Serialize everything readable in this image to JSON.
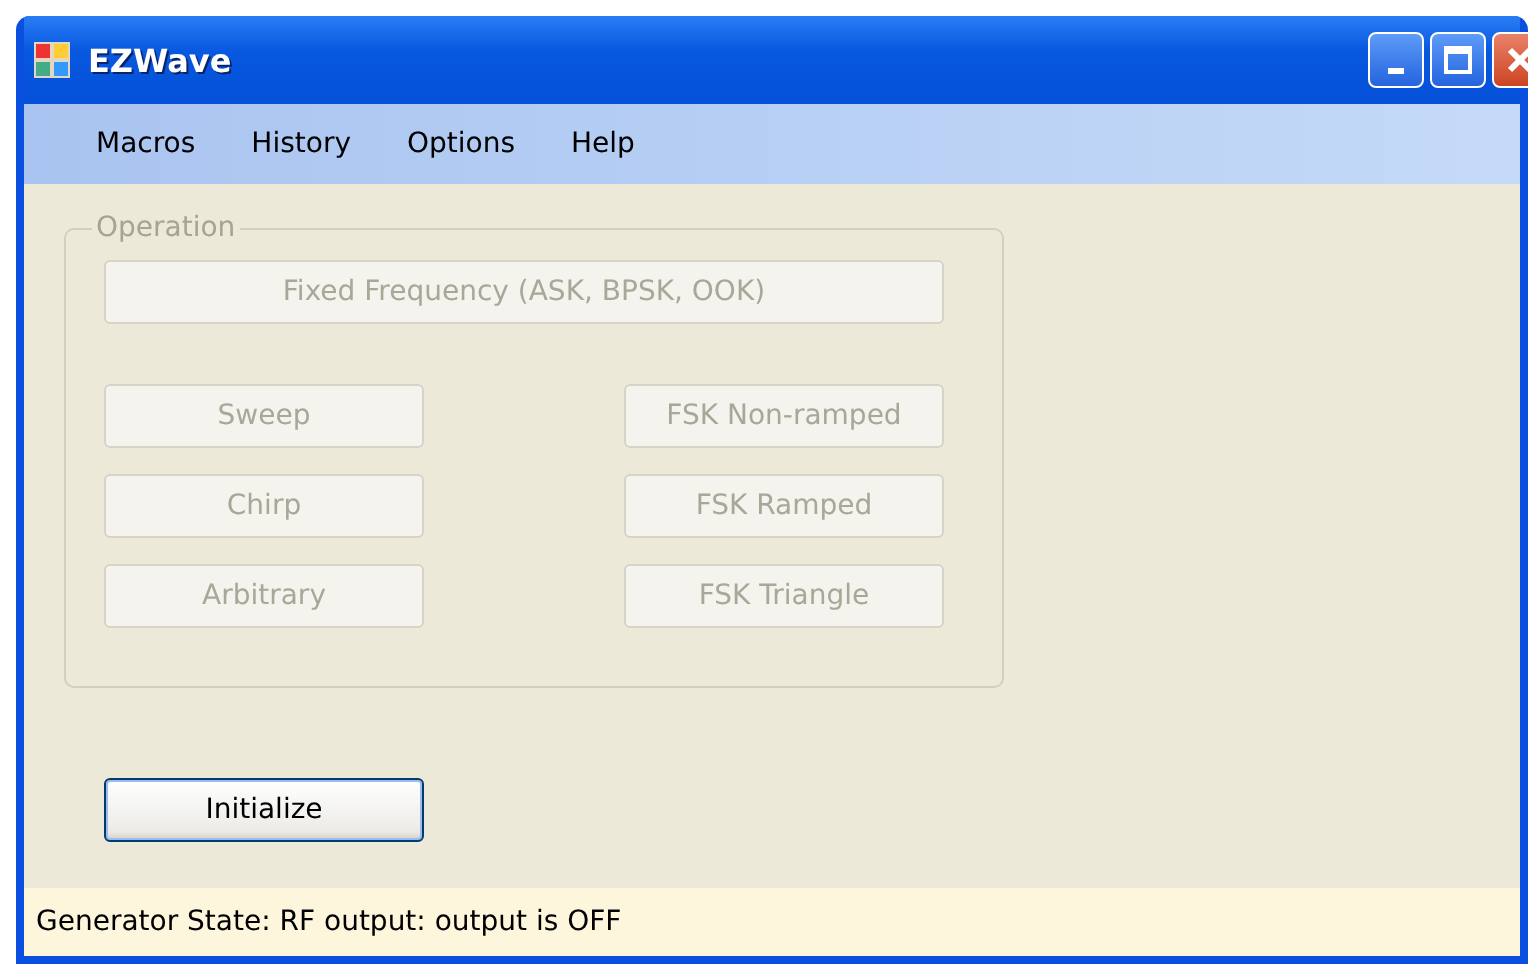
{
  "window": {
    "title": "EZWave"
  },
  "menu": [
    {
      "label": "Macros"
    },
    {
      "label": "History"
    },
    {
      "label": "Options"
    },
    {
      "label": "Help"
    }
  ],
  "operation": {
    "title": "Operation",
    "buttons": [
      {
        "label": "Fixed Frequency (ASK, BPSK, OOK)",
        "disabled": true,
        "kind": "wide"
      },
      {
        "label": "Sweep",
        "disabled": true,
        "kind": "half"
      },
      {
        "label": "FSK Non-ramped",
        "disabled": true,
        "kind": "half"
      },
      {
        "label": "Chirp",
        "disabled": true,
        "kind": "half"
      },
      {
        "label": "FSK Ramped",
        "disabled": true,
        "kind": "half"
      },
      {
        "label": "Arbitrary",
        "disabled": true,
        "kind": "half"
      },
      {
        "label": "FSK Triangle",
        "disabled": true,
        "kind": "half"
      }
    ]
  },
  "initialize": {
    "label": "Initialize",
    "disabled": false
  },
  "status_bar": {
    "text": "Generator State: RF output: output is OFF"
  }
}
